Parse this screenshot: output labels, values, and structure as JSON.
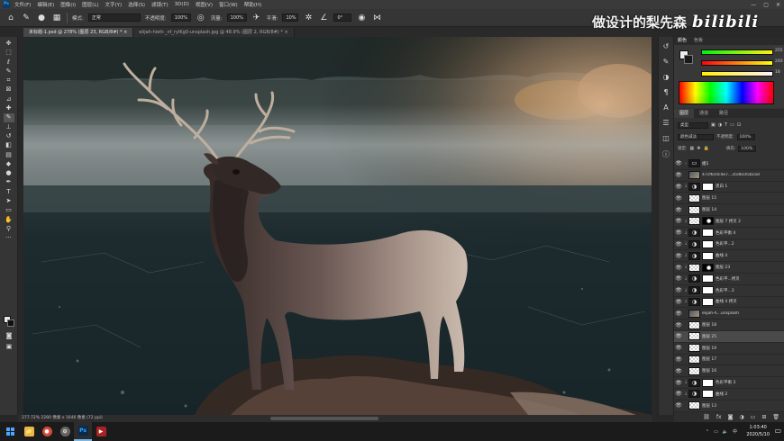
{
  "menu": [
    "文件(F)",
    "编辑(E)",
    "图像(I)",
    "图层(L)",
    "文字(Y)",
    "选择(S)",
    "滤镜(T)",
    "3D(D)",
    "视图(V)",
    "窗口(W)",
    "帮助(H)"
  ],
  "options": {
    "mode_label": "模式:",
    "mode_value": "正常",
    "opacity_label": "不透明度:",
    "opacity_value": "100%",
    "flow_label": "流量:",
    "flow_value": "100%",
    "smooth_label": "平滑:",
    "smooth_value": "10%",
    "angle_value": "0°"
  },
  "watermark": {
    "text": "做设计的梨先森",
    "logo": "bilibili"
  },
  "tabs": [
    {
      "label": "未标题-1.psd @ 278% (图层 23, RGB/8#) *"
    },
    {
      "label": "elijah-hiett-_nf_rylKg0-unsplash.jpg @ 48.9% (图层 2, RGB/8#) *"
    }
  ],
  "status": {
    "text": "277.72%   2280 像素 x 1646 像素 (72 ppi)"
  },
  "color_panel": {
    "tabs": [
      "颜色",
      "色板"
    ],
    "r_value": "255",
    "g_value": "240",
    "b_value": "18"
  },
  "layers_panel": {
    "tabs": [
      "图层",
      "通道",
      "路径"
    ],
    "kind_label": "类型",
    "blend_mode": "颜色减淡",
    "opacity_label": "不透明度:",
    "opacity_value": "100%",
    "lock_label": "锁定:",
    "fill_label": "填充:",
    "fill_value": "100%",
    "layers": [
      {
        "name": "组1",
        "type": "group",
        "selected": false
      },
      {
        "name": "47cf6c0c4e7...35d6c45bcad",
        "type": "image",
        "selected": false
      },
      {
        "name": "黑白 1",
        "type": "adjust",
        "selected": false
      },
      {
        "name": "图层 15",
        "type": "pixel",
        "selected": false
      },
      {
        "name": "图层 14",
        "type": "pixel",
        "selected": false
      },
      {
        "name": "图层 7 拷贝 2",
        "type": "mask",
        "selected": false
      },
      {
        "name": "色彩平衡 4",
        "type": "adjust",
        "selected": false
      },
      {
        "name": "色彩平...2",
        "type": "adjust",
        "selected": false
      },
      {
        "name": "曲线 4",
        "type": "adjust",
        "selected": false
      },
      {
        "name": "图层 23",
        "type": "mask",
        "selected": false
      },
      {
        "name": "色彩平...拷贝",
        "type": "adjust",
        "selected": false
      },
      {
        "name": "色彩平...3",
        "type": "adjust",
        "selected": false
      },
      {
        "name": "曲线 4 拷贝",
        "type": "adjust",
        "selected": false
      },
      {
        "name": "elijah-h...unsplash",
        "type": "image",
        "selected": false
      },
      {
        "name": "图层 18",
        "type": "pixel",
        "selected": false
      },
      {
        "name": "图层 25",
        "type": "pixel",
        "selected": true
      },
      {
        "name": "图层 19",
        "type": "pixel",
        "selected": false
      },
      {
        "name": "图层 17",
        "type": "pixel",
        "selected": false
      },
      {
        "name": "图层 16",
        "type": "pixel",
        "selected": false
      },
      {
        "name": "色彩平衡 3",
        "type": "adjust",
        "selected": false
      },
      {
        "name": "曲线 2",
        "type": "adjust",
        "selected": false
      },
      {
        "name": "图层 13",
        "type": "pixel",
        "selected": false
      }
    ]
  },
  "taskbar": {
    "time": "1:03:40",
    "date": "2020/5/10",
    "ime": "中",
    "apps": [
      {
        "name": "file-explorer",
        "letter": "📁",
        "color": "#e8b84a"
      },
      {
        "name": "chrome",
        "letter": "●",
        "color": "#d44a3a"
      },
      {
        "name": "app",
        "letter": "⊙",
        "color": "#666"
      },
      {
        "name": "photoshop",
        "letter": "Ps",
        "color": "#0a2a4a"
      },
      {
        "name": "media",
        "letter": "▶",
        "color": "#a22"
      }
    ]
  }
}
